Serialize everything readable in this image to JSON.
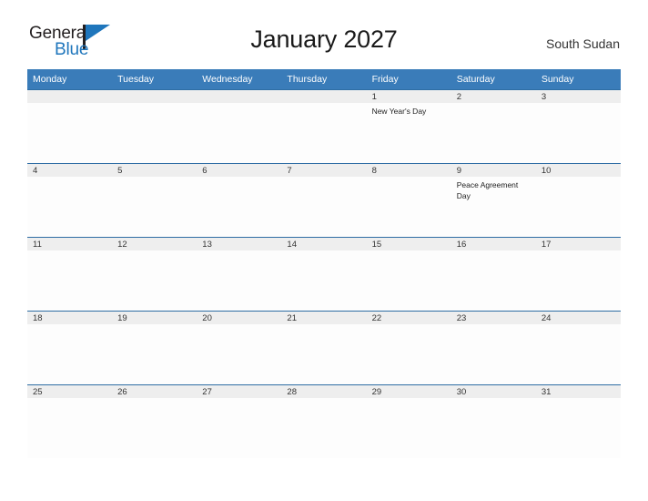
{
  "brand": {
    "name_dark": "General",
    "name_blue": "Blue",
    "flag_icon": "triangle-flag-icon",
    "dark_color": "#231f20",
    "blue_color": "#1f76bc"
  },
  "header": {
    "title": "January 2027",
    "region": "South Sudan"
  },
  "theme": {
    "header_blue": "#3a7cb9",
    "row_rule_blue": "#2e6da4",
    "date_band_gray": "#eeeeee",
    "cell_bg": "#fdfdfd"
  },
  "calendar": {
    "weekday_headers": [
      "Monday",
      "Tuesday",
      "Wednesday",
      "Thursday",
      "Friday",
      "Saturday",
      "Sunday"
    ],
    "weeks": [
      [
        {
          "date": "",
          "events": []
        },
        {
          "date": "",
          "events": []
        },
        {
          "date": "",
          "events": []
        },
        {
          "date": "",
          "events": []
        },
        {
          "date": "1",
          "events": [
            "New Year's Day"
          ]
        },
        {
          "date": "2",
          "events": []
        },
        {
          "date": "3",
          "events": []
        }
      ],
      [
        {
          "date": "4",
          "events": []
        },
        {
          "date": "5",
          "events": []
        },
        {
          "date": "6",
          "events": []
        },
        {
          "date": "7",
          "events": []
        },
        {
          "date": "8",
          "events": []
        },
        {
          "date": "9",
          "events": [
            "Peace Agreement Day"
          ]
        },
        {
          "date": "10",
          "events": []
        }
      ],
      [
        {
          "date": "11",
          "events": []
        },
        {
          "date": "12",
          "events": []
        },
        {
          "date": "13",
          "events": []
        },
        {
          "date": "14",
          "events": []
        },
        {
          "date": "15",
          "events": []
        },
        {
          "date": "16",
          "events": []
        },
        {
          "date": "17",
          "events": []
        }
      ],
      [
        {
          "date": "18",
          "events": []
        },
        {
          "date": "19",
          "events": []
        },
        {
          "date": "20",
          "events": []
        },
        {
          "date": "21",
          "events": []
        },
        {
          "date": "22",
          "events": []
        },
        {
          "date": "23",
          "events": []
        },
        {
          "date": "24",
          "events": []
        }
      ],
      [
        {
          "date": "25",
          "events": []
        },
        {
          "date": "26",
          "events": []
        },
        {
          "date": "27",
          "events": []
        },
        {
          "date": "28",
          "events": []
        },
        {
          "date": "29",
          "events": []
        },
        {
          "date": "30",
          "events": []
        },
        {
          "date": "31",
          "events": []
        }
      ]
    ]
  }
}
